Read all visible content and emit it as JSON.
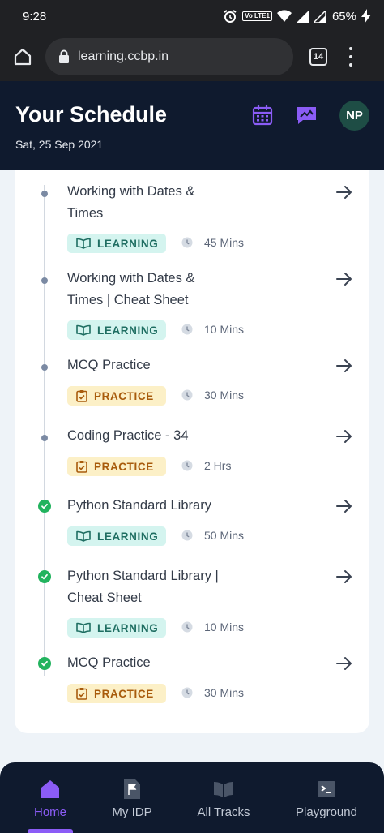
{
  "status_bar": {
    "time": "9:28",
    "volte": "Vo LTE1",
    "battery": "65%"
  },
  "browser": {
    "url": "learning.ccbp.in",
    "tab_count": "14"
  },
  "header": {
    "title": "Your Schedule",
    "date": "Sat, 25 Sep 2021",
    "avatar_initials": "NP"
  },
  "schedule": {
    "items": [
      {
        "title_lines": [
          "Working with Dates &",
          "Times"
        ],
        "badge": "LEARNING",
        "duration": "45 Mins",
        "completed": false
      },
      {
        "title_lines": [
          "Working with Dates &",
          "Times | Cheat Sheet"
        ],
        "badge": "LEARNING",
        "duration": "10 Mins",
        "completed": false
      },
      {
        "title_lines": [
          "MCQ Practice"
        ],
        "badge": "PRACTICE",
        "duration": "30 Mins",
        "completed": false
      },
      {
        "title_lines": [
          "Coding Practice - 34"
        ],
        "badge": "PRACTICE",
        "duration": "2 Hrs",
        "completed": false
      },
      {
        "title_lines": [
          "Python Standard Library"
        ],
        "badge": "LEARNING",
        "duration": "50 Mins",
        "completed": true
      },
      {
        "title_lines": [
          "Python Standard Library |",
          "Cheat Sheet"
        ],
        "badge": "LEARNING",
        "duration": "10 Mins",
        "completed": true
      },
      {
        "title_lines": [
          "MCQ Practice"
        ],
        "badge": "PRACTICE",
        "duration": "30 Mins",
        "completed": true
      }
    ]
  },
  "bottom_nav": {
    "items": [
      {
        "label": "Home",
        "icon": "home-icon",
        "active": true
      },
      {
        "label": "My IDP",
        "icon": "flag-doc-icon",
        "active": false
      },
      {
        "label": "All Tracks",
        "icon": "book-icon",
        "active": false
      },
      {
        "label": "Playground",
        "icon": "terminal-icon",
        "active": false
      }
    ]
  },
  "colors": {
    "header_bg": "#0f1a2e",
    "accent_purple": "#8b5cf6",
    "learning_bg": "#d4f4ef",
    "learning_text": "#1f6e62",
    "practice_bg": "#fcf0c7",
    "practice_text": "#a85b0c",
    "completed_green": "#22b35e"
  }
}
